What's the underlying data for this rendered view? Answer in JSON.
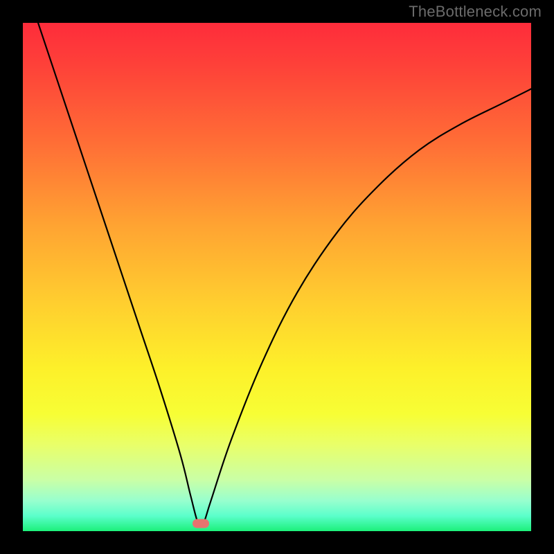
{
  "watermark": "TheBottleneck.com",
  "chart_data": {
    "type": "line",
    "title": "",
    "xlabel": "",
    "ylabel": "",
    "xlim": [
      0,
      100
    ],
    "ylim": [
      0,
      100
    ],
    "grid": false,
    "legend": false,
    "marker": {
      "x": 35,
      "y": 1.5,
      "color": "#e6736f"
    },
    "series": [
      {
        "name": "bottleneck-curve",
        "color": "#000000",
        "x": [
          3,
          7,
          11,
          15,
          19,
          23,
          27,
          31,
          33,
          34.5,
          35.5,
          37,
          41,
          47,
          54,
          62,
          70,
          78,
          86,
          94,
          100
        ],
        "values": [
          100,
          88,
          76,
          64,
          52,
          40,
          28,
          15,
          7,
          1.5,
          1.5,
          6,
          18,
          33,
          47,
          59,
          68,
          75,
          80,
          84,
          87
        ]
      }
    ],
    "background_gradient": {
      "type": "vertical",
      "stops": [
        {
          "pos": 0.0,
          "color": "#fe2c3b"
        },
        {
          "pos": 0.08,
          "color": "#fe4039"
        },
        {
          "pos": 0.24,
          "color": "#ff6f36"
        },
        {
          "pos": 0.4,
          "color": "#ffa432"
        },
        {
          "pos": 0.55,
          "color": "#ffce2f"
        },
        {
          "pos": 0.68,
          "color": "#fdf02a"
        },
        {
          "pos": 0.77,
          "color": "#f7fe35"
        },
        {
          "pos": 0.83,
          "color": "#e9ff69"
        },
        {
          "pos": 0.9,
          "color": "#c9ffa7"
        },
        {
          "pos": 0.94,
          "color": "#98ffce"
        },
        {
          "pos": 0.97,
          "color": "#5bffcb"
        },
        {
          "pos": 1.0,
          "color": "#1cf07a"
        }
      ]
    }
  }
}
